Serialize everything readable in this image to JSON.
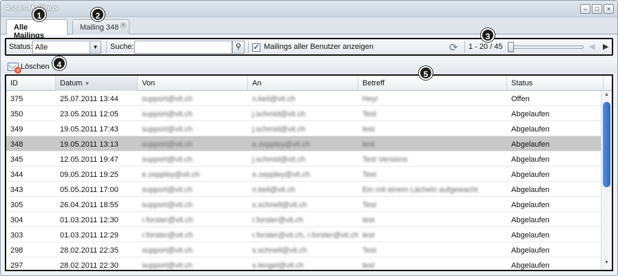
{
  "window": {
    "title": "Asset-Mailings",
    "buttons": [
      "minimize-icon",
      "maximize-icon",
      "close-icon"
    ]
  },
  "tabs": [
    {
      "label": "Alle Mailings",
      "active": true
    },
    {
      "label": "Mailing 348",
      "active": false
    }
  ],
  "toolbar": {
    "status_label": "Status:",
    "status_value": "Alle",
    "search_label": "Suche:",
    "search_value": "",
    "show_all_label": "Mailings aller Benutzer anzeigen",
    "show_all_checked": true,
    "paging_text": "1 - 20 / 45",
    "slider_position": 1
  },
  "actions": {
    "delete_label": "Löschen"
  },
  "callouts": [
    "1",
    "2",
    "3",
    "4",
    "5"
  ],
  "grid": {
    "columns": [
      "ID",
      "Datum",
      "Von",
      "An",
      "Betreff",
      "Status"
    ],
    "sorted_column": "Datum",
    "rows": [
      {
        "id": "375",
        "date": "25.07.2011 13:44",
        "from": "support@vit.ch",
        "to": "n.keil@vit.ch",
        "subject": "Hey!",
        "status": "Offen",
        "selected": false
      },
      {
        "id": "350",
        "date": "23.05.2011 12:05",
        "from": "support@vit.ch",
        "to": "j.schmid@vit.ch",
        "subject": "Test",
        "status": "Abgelaufen",
        "selected": false
      },
      {
        "id": "349",
        "date": "19.05.2011 17:43",
        "from": "support@vit.ch",
        "to": "j.schmid@vit.ch",
        "subject": "test",
        "status": "Abgelaufen",
        "selected": false
      },
      {
        "id": "348",
        "date": "19.05.2011 13:13",
        "from": "support@vit.ch",
        "to": "e.zeppley@vit.ch",
        "subject": "test",
        "status": "Abgelaufen",
        "selected": true
      },
      {
        "id": "345",
        "date": "12.05.2011 19:47",
        "from": "support@vit.ch",
        "to": "j.schmid@vit.ch",
        "subject": "Test Versions",
        "status": "Abgelaufen",
        "selected": false
      },
      {
        "id": "344",
        "date": "09.05.2011 19:25",
        "from": "e.zeppley@vit.ch",
        "to": "e.zeppley@vit.ch",
        "subject": "Test",
        "status": "Abgelaufen",
        "selected": false
      },
      {
        "id": "343",
        "date": "05.05.2011 17:00",
        "from": "support@vit.ch",
        "to": "n.keil@vit.ch",
        "subject": "Ein mit einem Lächeln aufgewacht",
        "status": "Abgelaufen",
        "selected": false
      },
      {
        "id": "305",
        "date": "26.04.2011 18:55",
        "from": "support@vit.ch",
        "to": "s.schnell@vit.ch",
        "subject": "Test",
        "status": "Abgelaufen",
        "selected": false
      },
      {
        "id": "304",
        "date": "01.03.2011 12:30",
        "from": "r.forster@vit.ch",
        "to": "r.forster@vit.ch",
        "subject": "test",
        "status": "Abgelaufen",
        "selected": false
      },
      {
        "id": "303",
        "date": "01.03.2011 12:29",
        "from": "r.forster@vit.ch",
        "to": "r.forster@vit.ch, r.forster@vit.ch",
        "subject": "test",
        "status": "Abgelaufen",
        "selected": false
      },
      {
        "id": "298",
        "date": "28.02.2011 22:35",
        "from": "support@vit.ch",
        "to": "s.schnell@vit.ch",
        "subject": "Test",
        "status": "Abgelaufen",
        "selected": false
      },
      {
        "id": "297",
        "date": "28.02.2011 22:30",
        "from": "support@vit.ch",
        "to": "s.lengel@vit.ch",
        "subject": "test",
        "status": "Abgelaufen",
        "selected": false
      }
    ]
  }
}
